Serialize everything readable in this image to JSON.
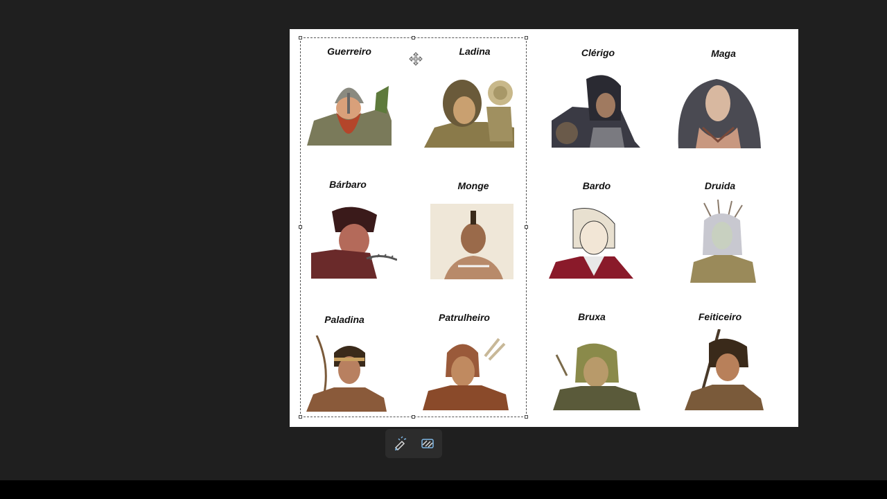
{
  "characters": {
    "guerreiro": "Guerreiro",
    "ladina": "Ladina",
    "clerigo": "Clérigo",
    "maga": "Maga",
    "barbaro": "Bárbaro",
    "monge": "Monge",
    "bardo": "Bardo",
    "druida": "Druida",
    "paladina": "Paladina",
    "patrulheiro": "Patrulheiro",
    "bruxa": "Bruxa",
    "feiticeiro": "Feiticeiro"
  },
  "toolbar": {
    "tool1_icon": "magic-edit-icon",
    "tool2_icon": "arrange-icon"
  },
  "colors": {
    "background": "#1f1f1f",
    "canvas": "#ffffff",
    "toolbar": "#2c2c2c",
    "accent": "#7fb8e6"
  }
}
